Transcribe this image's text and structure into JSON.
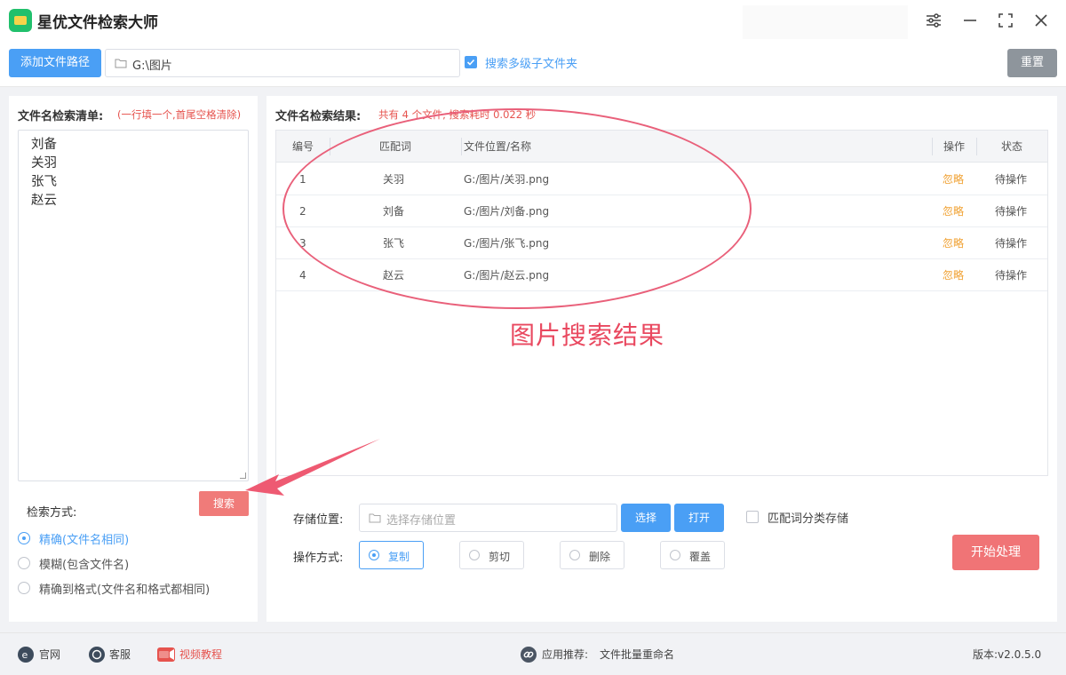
{
  "app": {
    "title": "星优文件检索大师"
  },
  "pathbar": {
    "add_label": "添加文件路径",
    "path_value": "G:\\图片",
    "subfolder_label": "搜索多级子文件夹",
    "reset_label": "重置"
  },
  "left": {
    "title": "文件名检索清单:",
    "hint": "(一行填一个,首尾空格清除)",
    "names": [
      "刘备",
      "关羽",
      "张飞",
      "赵云"
    ],
    "search_label": "搜索",
    "mode_label": "检索方式:",
    "modes": [
      "精确(文件名相同)",
      "模糊(包含文件名)",
      "精确到格式(文件名和格式都相同)"
    ]
  },
  "right": {
    "title": "文件名检索结果:",
    "summary": "共有 4 个文件, 搜索耗时 0.022 秒",
    "columns": [
      "编号",
      "匹配词",
      "文件位置/名称",
      "操作",
      "状态"
    ],
    "rows": [
      {
        "no": "1",
        "word": "关羽",
        "path": "G:/图片/关羽.png",
        "action": "忽略",
        "status": "待操作"
      },
      {
        "no": "2",
        "word": "刘备",
        "path": "G:/图片/刘备.png",
        "action": "忽略",
        "status": "待操作"
      },
      {
        "no": "3",
        "word": "张飞",
        "path": "G:/图片/张飞.png",
        "action": "忽略",
        "status": "待操作"
      },
      {
        "no": "4",
        "word": "赵云",
        "path": "G:/图片/赵云.png",
        "action": "忽略",
        "status": "待操作"
      }
    ],
    "annotation": "图片搜索结果",
    "store_label": "存储位置:",
    "store_placeholder": "选择存储位置",
    "choose_label": "选择",
    "open_label": "打开",
    "classify_label": "匹配词分类存储",
    "op_label": "操作方式:",
    "ops": [
      "复制",
      "剪切",
      "删除",
      "覆盖"
    ],
    "start_label": "开始处理"
  },
  "footer": {
    "site": "官网",
    "service": "客服",
    "video": "视频教程",
    "recommend_label": "应用推荐:",
    "recommend_app": "文件批量重命名",
    "version": "版本:v2.0.5.0"
  },
  "colors": {
    "accent": "#4a9ff5",
    "danger": "#f07476",
    "warning": "#f0a030"
  }
}
